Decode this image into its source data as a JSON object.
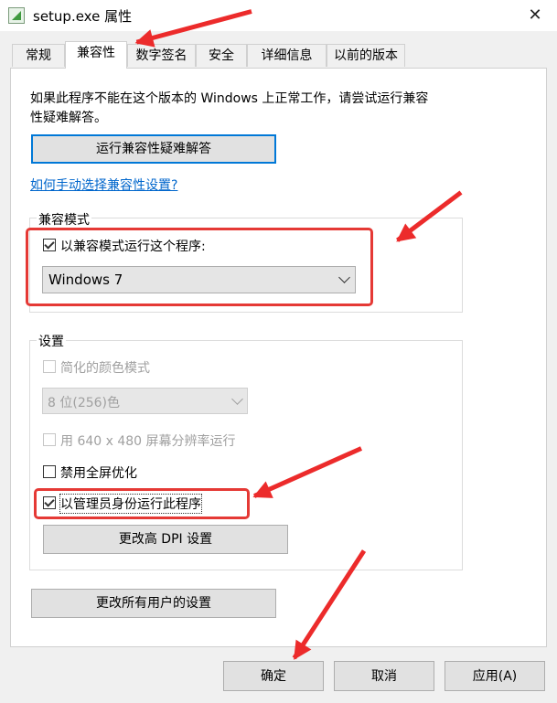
{
  "window": {
    "title": "setup.exe 属性",
    "close_symbol": "✕"
  },
  "tabs": [
    {
      "label": "常规",
      "active": false
    },
    {
      "label": "兼容性",
      "active": true
    },
    {
      "label": "数字签名",
      "active": false
    },
    {
      "label": "安全",
      "active": false
    },
    {
      "label": "详细信息",
      "active": false
    },
    {
      "label": "以前的版本",
      "active": false
    }
  ],
  "intro": {
    "line1": "如果此程序不能在这个版本的 Windows 上正常工作，请尝试运行兼容",
    "line2": "性疑难解答。"
  },
  "buttons": {
    "troubleshooter": "运行兼容性疑难解答",
    "change_dpi": "更改高 DPI 设置",
    "change_all_users": "更改所有用户的设置",
    "ok": "确定",
    "cancel": "取消",
    "apply": "应用(A)"
  },
  "link": {
    "manual": "如何手动选择兼容性设置?"
  },
  "compat_mode": {
    "group_label": "兼容模式",
    "checkbox_label": "以兼容模式运行这个程序:",
    "checked": true,
    "selected_os": "Windows 7"
  },
  "settings": {
    "group_label": "设置",
    "reduced_color_label": "简化的颜色模式",
    "reduced_color_checked": false,
    "color_select_value": "8 位(256)色",
    "res_640_label": "用 640 x 480 屏幕分辨率运行",
    "res_640_checked": false,
    "disable_fullscreen_label": "禁用全屏优化",
    "disable_fullscreen_checked": false,
    "run_as_admin_label": "以管理员身份运行此程序",
    "run_as_admin_checked": true
  },
  "colors": {
    "accent": "#0078d7",
    "annotation": "#e53935"
  }
}
